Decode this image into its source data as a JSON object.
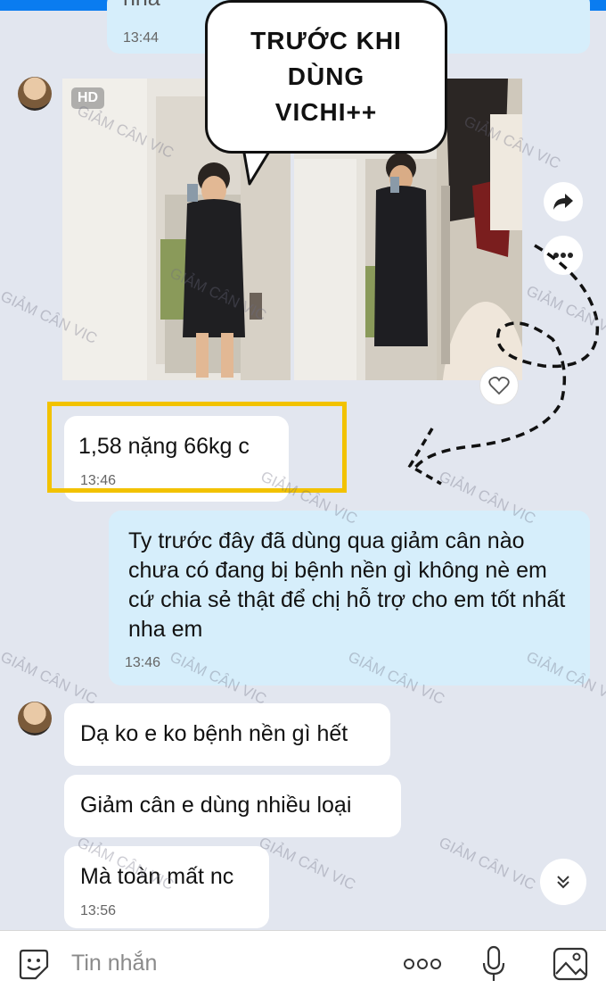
{
  "top_message": {
    "partial_text": "nha",
    "time": "13:44"
  },
  "image_message": {
    "badge": "HD",
    "callout_text": "TRƯỚC KHI\nDÙNG\nVICHI++"
  },
  "messages": [
    {
      "id": "m1",
      "text": "1,58 nặng 66kg c",
      "time": "13:46"
    },
    {
      "id": "m2",
      "text": "Ty trước đây đã dùng qua giảm cân nào chưa có đang bị bệnh nền gì không nè em cứ chia sẻ thật để chị hỗ trợ cho em tốt nhất nha em",
      "time": "13:46"
    },
    {
      "id": "m3",
      "text": "Dạ ko e ko bệnh nền gì hết"
    },
    {
      "id": "m4",
      "text": "Giảm cân e dùng nhiều loại"
    },
    {
      "id": "m5",
      "text": "Mà toàn mất nc",
      "time": "13:56"
    }
  ],
  "watermark": "GIẢM CÂN VIC",
  "input": {
    "placeholder": "Tin nhắn"
  },
  "icons": [
    "share-icon",
    "more-icon",
    "heart-icon",
    "scroll-down-icon",
    "sticker-icon",
    "more-dots-icon",
    "microphone-icon",
    "image-icon"
  ],
  "colors": {
    "outgoing_bubble": "#d6eefb",
    "highlight": "#f2c200",
    "topbar": "#0a7cf0"
  }
}
